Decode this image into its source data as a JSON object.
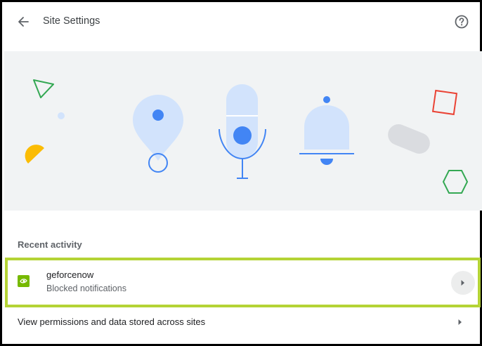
{
  "header": {
    "title": "Site Settings",
    "back_icon": "arrow-back-icon",
    "help_icon": "help-circle-icon"
  },
  "hero": {
    "illustration": [
      "location-pin",
      "microphone",
      "notification-bell",
      "triangle",
      "hexagon",
      "square",
      "half-circle",
      "pill"
    ]
  },
  "recent_activity": {
    "label": "Recent activity",
    "items": [
      {
        "site": "geforcenow",
        "status": "Blocked notifications",
        "icon": "nvidia-icon"
      }
    ]
  },
  "permissions_link": {
    "label": "View permissions and data stored across sites"
  },
  "colors": {
    "highlight_border": "#b4d335",
    "hero_bg": "#f1f3f4",
    "accent_blue": "#4285f4",
    "light_blue": "#d2e3fc",
    "nvidia_green": "#76b900"
  }
}
